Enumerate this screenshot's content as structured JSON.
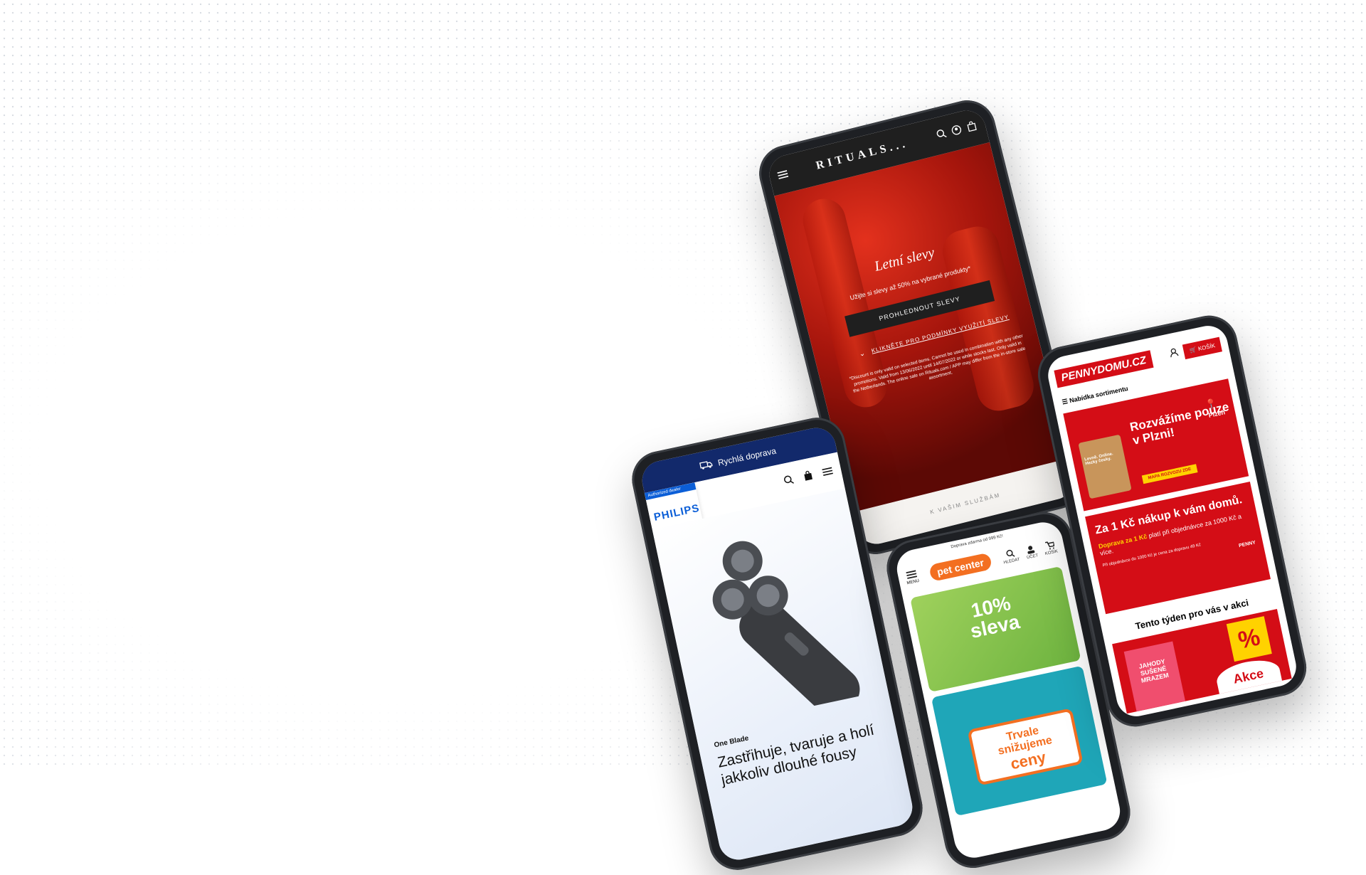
{
  "background": {
    "color": "#ffffff",
    "dot_color": "#d9dde3"
  },
  "rituals": {
    "logo": "RITUALS...",
    "title": "Letní slevy",
    "subtitle": "Užijte si slevy až 50% na vybrané produkty*",
    "button": "PROHLEDNOUT SLEVY",
    "link": "KLIKNĚTE PRO PODMÍNKY VYUŽITÍ SLEVY",
    "fine_print": "*Discount is only valid on selected items. Cannot be used in combination with any other promotions. Valid from 13/06/2022 until 14/07/2022 or while stocks last. Only valid in the Netherlands. The online sale on Rituals.com / APP may differ from the in-store sale assortment.",
    "footer": "K VAŠIM SLUŽBÁM",
    "colors": {
      "accent": "#c41a0f",
      "dark": "#1f1f1f"
    }
  },
  "philips": {
    "promo_bar": "Rychlá doprava",
    "badge": "Authorized dealer",
    "logo": "PHILIPS",
    "kicker": "One Blade",
    "title": "Zastřihuje, tvaruje a holí jakkoliv dlouhé fousy",
    "colors": {
      "brand": "#0b5ed7",
      "bar": "#12296b"
    }
  },
  "petcenter": {
    "top_bar": "Doprava zdarma od 999 Kč!",
    "logo": "pet center",
    "icons": {
      "menu": "MENU",
      "search": "HLEDAT",
      "account": "ÚČET",
      "cart": "KOŠÍK"
    },
    "banner1": {
      "line1": "10%",
      "line2": "sleva"
    },
    "banner2": {
      "line1": "Trvale",
      "line2": "snižujeme",
      "line3": "ceny"
    },
    "colors": {
      "brand": "#f36f21"
    }
  },
  "penny": {
    "logo": "PENNYDOMU.CZ",
    "cart": "KOŠÍK",
    "menu": "Nabídka sortimentu",
    "banner1": {
      "title": "Rozvážíme pouze v Plzni!",
      "city": "Plzeň",
      "bag": "Levně. Online. Hezky česky.",
      "button": "MAPA ROZVOZU ZDE"
    },
    "banner2": {
      "title": "Za 1 Kč nákup k vám domů.",
      "highlight": "Doprava za 1 Kč",
      "text": "platí při objednávce za 1000 Kč a více.",
      "fine": "Při objednávce do 1000 Kč je cena za dopravu 49 Kč",
      "brand": "PENNY"
    },
    "week_title": "Tento týden pro vás v akci",
    "product": "JAHODY SUŠENÉ MRAZEM",
    "tag": "%",
    "akce": "Akce",
    "colors": {
      "brand": "#d40d16",
      "yellow": "#ffd200"
    }
  }
}
